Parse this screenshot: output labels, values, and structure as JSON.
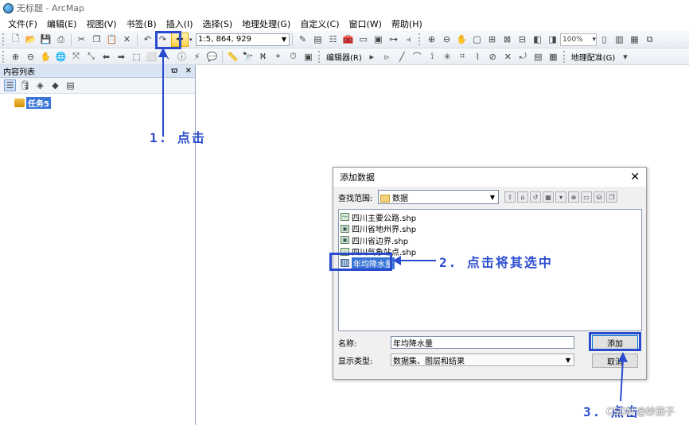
{
  "window": {
    "title": "无标题 - ArcMap"
  },
  "menu": [
    "文件(F)",
    "编辑(E)",
    "视图(V)",
    "书签(B)",
    "插入(I)",
    "选择(S)",
    "地理处理(G)",
    "自定义(C)",
    "窗口(W)",
    "帮助(H)"
  ],
  "toolbar": {
    "scale": "1:5, 864, 929",
    "zoom": "100%",
    "editor_label": "编辑器(R)",
    "georef_label": "地理配准(G)"
  },
  "toc": {
    "title": "内容列表",
    "pin": "ϖ",
    "close": "✕",
    "layer": "任务5"
  },
  "dialog": {
    "title": "添加数据",
    "look_in_label": "查找范围:",
    "look_in_value": "数据",
    "files": [
      {
        "name": "四川主要公路.shp",
        "icon": "line-shp-icon"
      },
      {
        "name": "四川省地州界.shp",
        "icon": "polygon-shp-icon"
      },
      {
        "name": "四川省边界.shp",
        "icon": "polygon-shp-icon"
      },
      {
        "name": "四川气象站点.shp",
        "icon": "point-shp-icon"
      },
      {
        "name": "年均降水量",
        "icon": "raster-icon",
        "selected": true
      }
    ],
    "name_label": "名称:",
    "name_value": "年均降水量",
    "type_label": "显示类型:",
    "type_value": "数据集、图层和结果",
    "add_button": "添加",
    "cancel_button": "取消"
  },
  "annotations": {
    "step1": "1. 点击",
    "step2": "2. 点击将其选中",
    "step3": "3. 点击"
  },
  "watermark": "CSDN @妙茄子",
  "colors": {
    "annotation": "#2a4bd0",
    "selection": "#3875d7"
  }
}
